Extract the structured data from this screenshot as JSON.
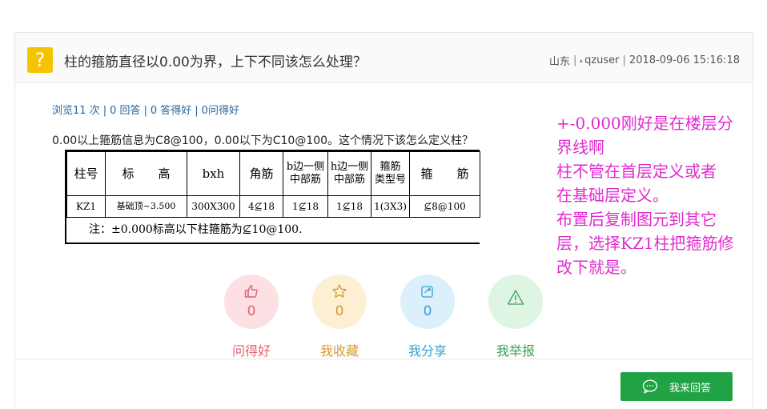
{
  "question": {
    "icon": "question-icon",
    "icon_glyph": "?",
    "title": "柱的箍筋直径以0.00为界，上下不同该怎么处理？",
    "region": "山东",
    "user": "qzuser",
    "datetime": "2018-09-06 15:16:18"
  },
  "stats": {
    "views": "浏览11 次",
    "answers": "0 回答",
    "good_answers": "0 答得好",
    "good_questions": "0问得好"
  },
  "body": {
    "text": "0.00以上箍筋信息为C8@100，0.00以下为C10@100。这个情况下该怎么定义柱？"
  },
  "spec_table": {
    "headers": [
      "柱号",
      "标　　高",
      "bxh",
      "角筋",
      "b边一侧\n中部筋",
      "h边一侧\n中部筋",
      "箍筋\n类型号",
      "箍　　筋"
    ],
    "row": [
      "KZ1",
      "基础顶~3.500",
      "300X300",
      "4⊈18",
      "1⊈18",
      "1⊈18",
      "1(3X3)",
      "⊈8@100"
    ],
    "note": "注：±0.000标高以下柱箍筋为⊈10@100."
  },
  "answer_lines": [
    "+-0.000刚好是在楼层分",
    "界线啊",
    "柱不管在首层定义或者",
    "在基础层定义。",
    "布置后复制图元到其它",
    "层，选择KZ1柱把箍筋修",
    "改下就是。"
  ],
  "actions": {
    "like": {
      "count": "0",
      "label": "问得好",
      "icon": "thumbs-up-icon"
    },
    "favorite": {
      "count": "0",
      "label": "我收藏",
      "icon": "star-icon"
    },
    "share": {
      "count": "0",
      "label": "我分享",
      "icon": "share-icon"
    },
    "report": {
      "count": "0",
      "label": "我举报",
      "icon": "warning-icon"
    }
  },
  "reply_button": {
    "label": "我来回答",
    "icon": "chat-bubble-icon"
  },
  "colors": {
    "accent_green": "#20a245",
    "question_icon": "#f5c400",
    "answer_text": "#e22ad0",
    "link_blue": "#2a6496"
  }
}
